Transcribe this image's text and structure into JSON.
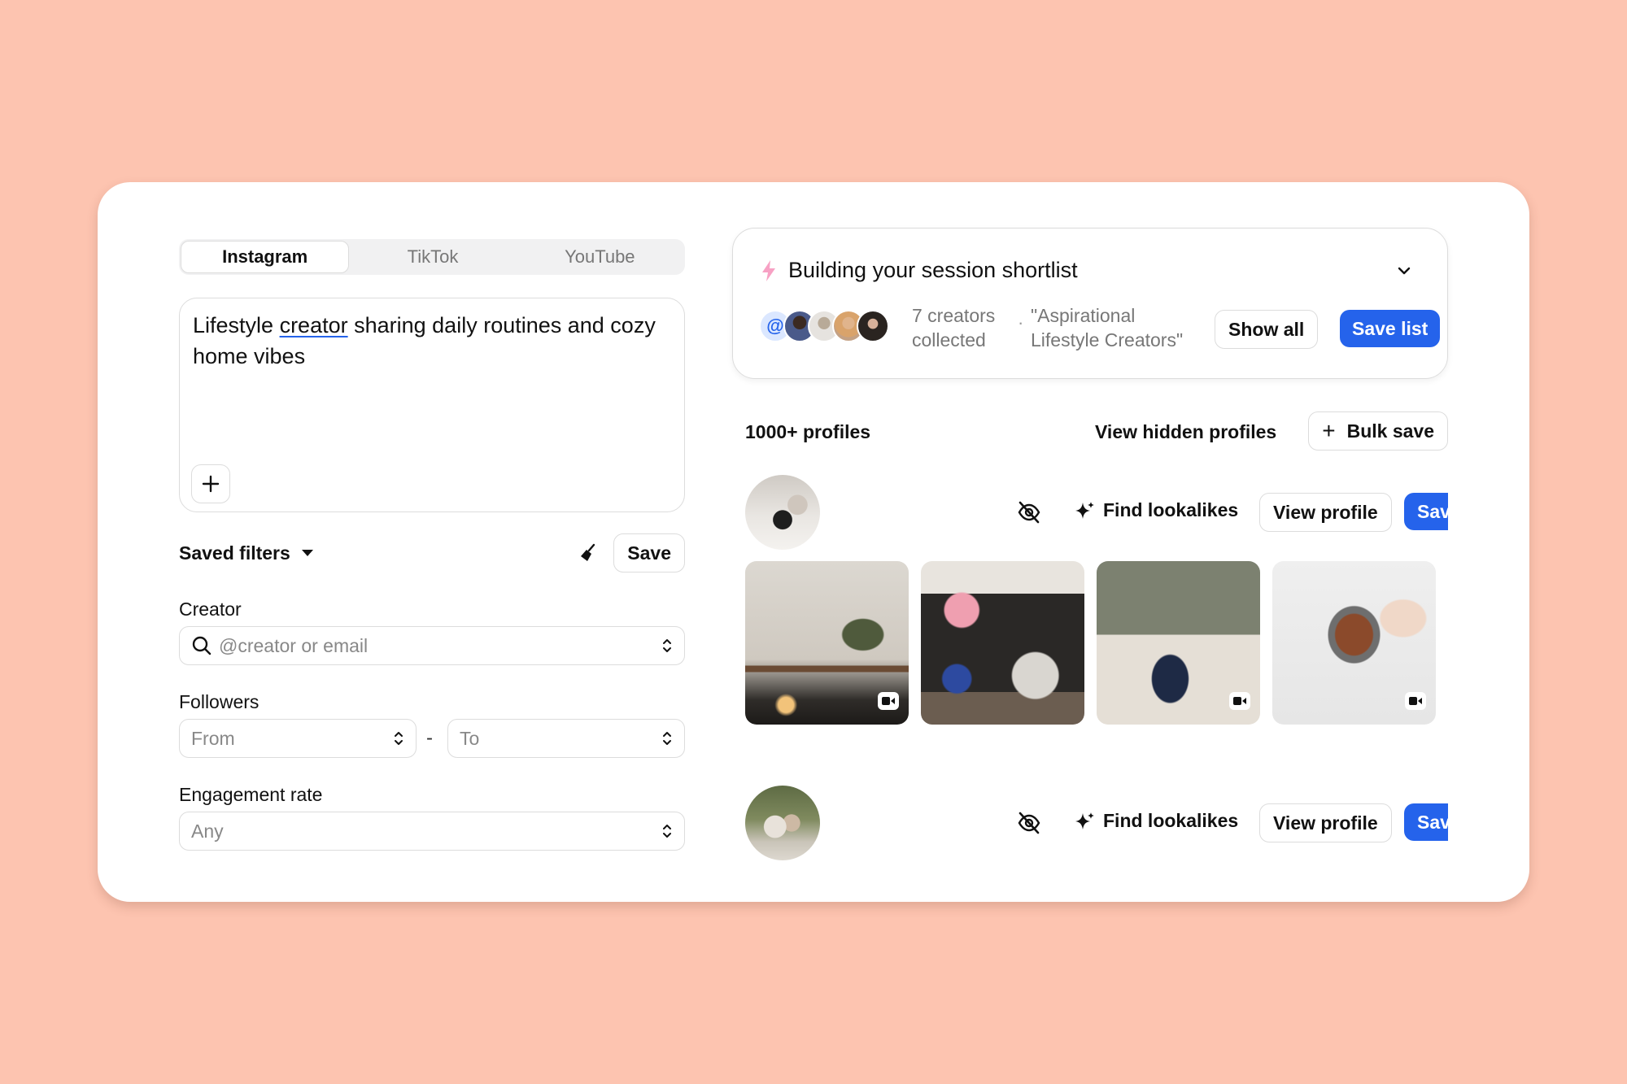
{
  "platform_tabs": [
    {
      "label": "Instagram",
      "active": true
    },
    {
      "label": "TikTok",
      "active": false
    },
    {
      "label": "YouTube",
      "active": false
    }
  ],
  "prompt": {
    "before": "Lifestyle ",
    "underlined": "creator",
    "after": " sharing daily routines and cozy home vibes"
  },
  "filters": {
    "saved_filters_label": "Saved filters",
    "save_label": "Save",
    "creator_label": "Creator",
    "creator_placeholder": "@creator or email",
    "followers_label": "Followers",
    "followers_from": "From",
    "followers_to": "To",
    "separator": "-",
    "engagement_label": "Engagement rate",
    "engagement_value": "Any"
  },
  "shortlist": {
    "title": "Building your session shortlist",
    "count_text": "7 creators collected",
    "list_name": "\"Aspirational Lifestyle Creators\"",
    "show_all": "Show all",
    "save_list": "Save list",
    "at_symbol": "@"
  },
  "results": {
    "count": "1000+ profiles",
    "view_hidden": "View hidden profiles",
    "bulk_save": "Bulk save"
  },
  "profile_actions": {
    "find_lookalikes": "Find lookalikes",
    "view_profile": "View profile",
    "save": "Sav"
  },
  "colors": {
    "background": "#fdc4b0",
    "accent": "#2563eb",
    "bolt": "#f7a1c4"
  },
  "icons": [
    "search-icon",
    "stepper-icon",
    "plus-icon",
    "broom-icon",
    "caret-down-icon",
    "bolt-icon",
    "chevron-down-icon",
    "eye-off-icon",
    "sparkle-icon",
    "video-icon"
  ]
}
